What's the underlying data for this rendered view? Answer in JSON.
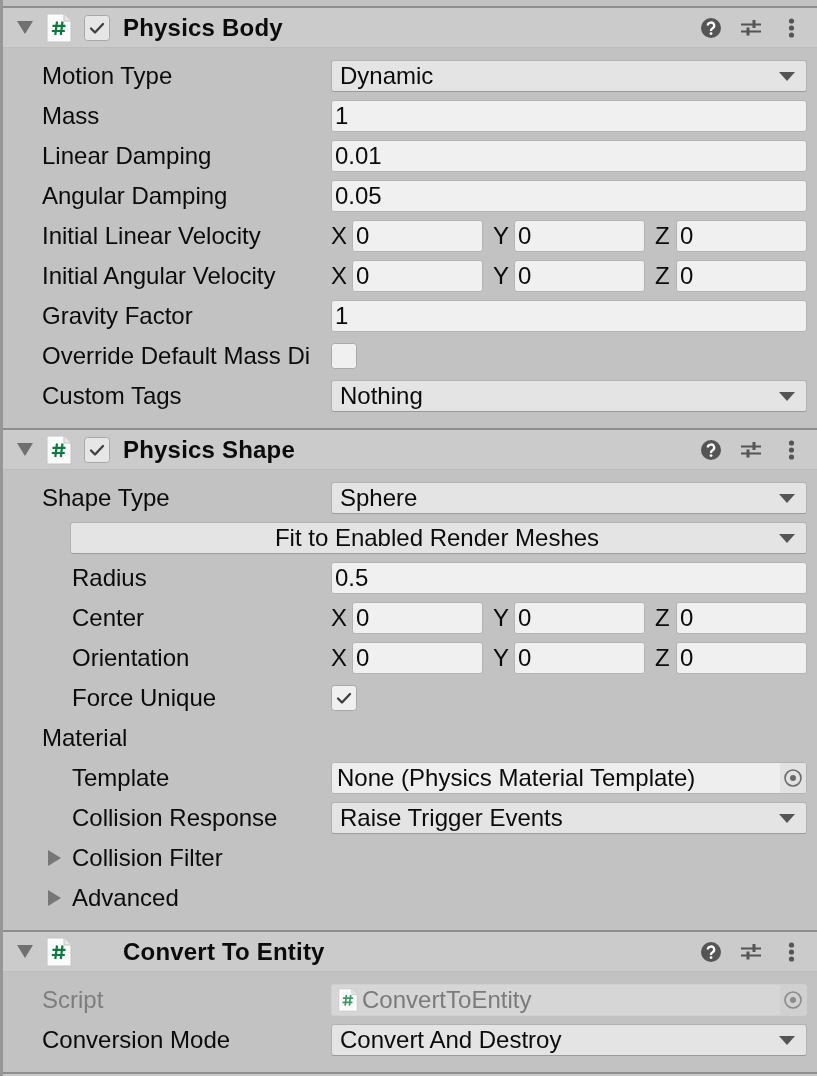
{
  "components": [
    {
      "title": "Physics Body",
      "expanded": true,
      "toggle": {
        "checked": true
      },
      "rows": [
        {
          "kind": "dropdown",
          "label": "Motion Type",
          "value": "Dynamic"
        },
        {
          "kind": "text",
          "label": "Mass",
          "value": "1"
        },
        {
          "kind": "text",
          "label": "Linear Damping",
          "value": "0.01"
        },
        {
          "kind": "text",
          "label": "Angular Damping",
          "value": "0.05"
        },
        {
          "kind": "vector3",
          "label": "Initial Linear Velocity",
          "axes": [
            {
              "axis": "X",
              "value": "0"
            },
            {
              "axis": "Y",
              "value": "0"
            },
            {
              "axis": "Z",
              "value": "0"
            }
          ]
        },
        {
          "kind": "vector3",
          "label": "Initial Angular Velocity",
          "axes": [
            {
              "axis": "X",
              "value": "0"
            },
            {
              "axis": "Y",
              "value": "0"
            },
            {
              "axis": "Z",
              "value": "0"
            }
          ]
        },
        {
          "kind": "text",
          "label": "Gravity Factor",
          "value": "1"
        },
        {
          "kind": "checkbox",
          "label": "Override Default Mass Di",
          "checked": false
        },
        {
          "kind": "dropdown",
          "label": "Custom Tags",
          "value": "Nothing"
        }
      ]
    },
    {
      "title": "Physics Shape",
      "expanded": true,
      "toggle": {
        "checked": true
      },
      "rows": [
        {
          "kind": "dropdown",
          "label": "Shape Type",
          "value": "Sphere",
          "children": [
            {
              "kind": "popup-button",
              "value": "Fit to Enabled Render Meshes"
            },
            {
              "kind": "text",
              "label": "Radius",
              "value": "0.5"
            },
            {
              "kind": "vector3",
              "label": "Center",
              "axes": [
                {
                  "axis": "X",
                  "value": "0"
                },
                {
                  "axis": "Y",
                  "value": "0"
                },
                {
                  "axis": "Z",
                  "value": "0"
                }
              ]
            },
            {
              "kind": "vector3",
              "label": "Orientation",
              "axes": [
                {
                  "axis": "X",
                  "value": "0"
                },
                {
                  "axis": "Y",
                  "value": "0"
                },
                {
                  "axis": "Z",
                  "value": "0"
                }
              ]
            },
            {
              "kind": "checkbox",
              "label": "Force Unique",
              "checked": true
            }
          ]
        },
        {
          "kind": "section",
          "label": "Material",
          "children": [
            {
              "kind": "object",
              "label": "Template",
              "value": "None (Physics Material Template)"
            },
            {
              "kind": "dropdown",
              "label": "Collision Response",
              "value": "Raise Trigger Events"
            },
            {
              "kind": "foldout",
              "label": "Collision Filter",
              "expanded": false
            },
            {
              "kind": "foldout",
              "label": "Advanced",
              "expanded": false
            }
          ]
        }
      ]
    },
    {
      "title": "Convert To Entity",
      "expanded": true,
      "rows": [
        {
          "kind": "script",
          "label": "Script",
          "value": "ConvertToEntity",
          "disabled": true
        },
        {
          "kind": "dropdown",
          "label": "Conversion Mode",
          "value": "Convert And Destroy",
          "disabled": false
        }
      ]
    }
  ]
}
